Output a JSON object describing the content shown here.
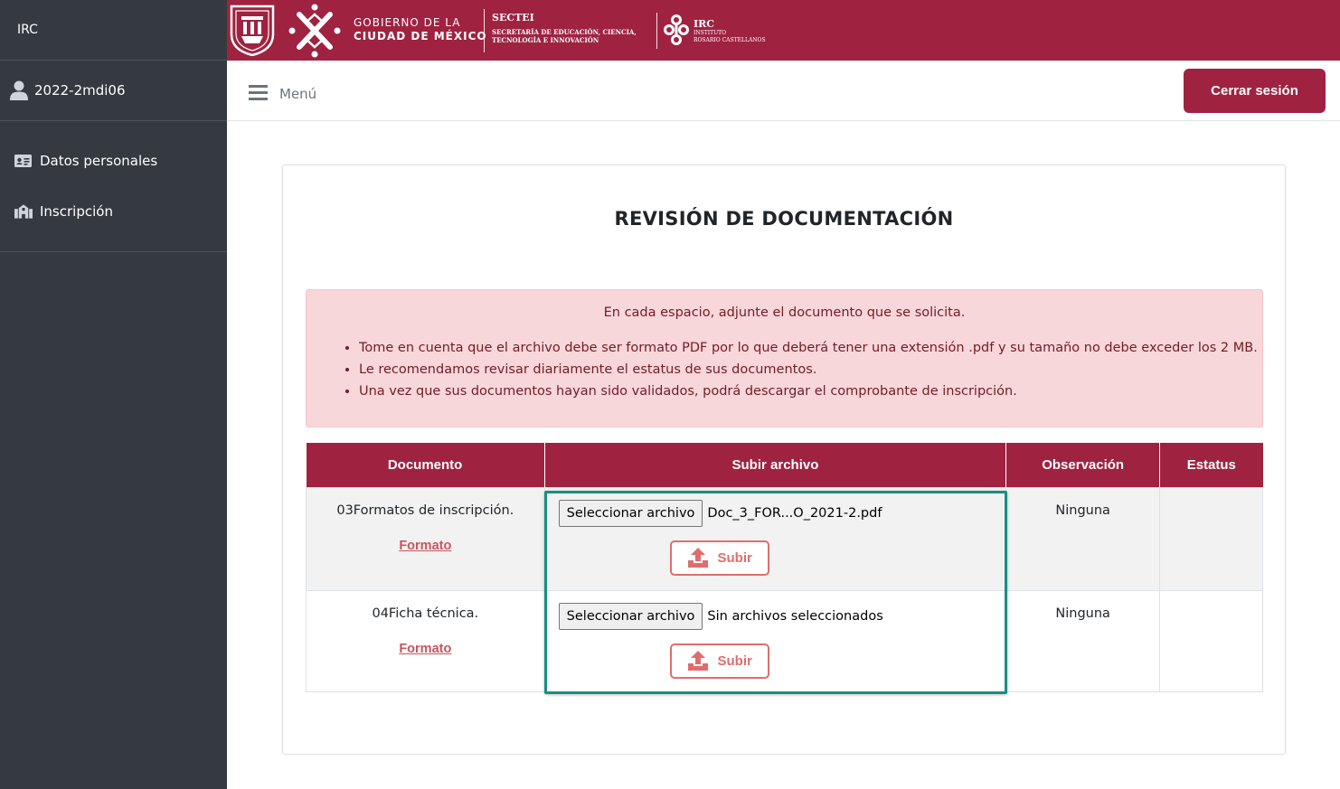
{
  "sidebar": {
    "brand": "IRC",
    "user": {
      "name": "2022-2mdi06",
      "icon": "user-icon"
    },
    "items": [
      {
        "label": "Datos personales",
        "icon": "id-card-icon"
      },
      {
        "label": "Inscripción",
        "icon": "school-icon"
      }
    ]
  },
  "banner": {
    "gob_line1": "GOBIERNO DE LA",
    "gob_line2": "CIUDAD DE MÉXICO",
    "sectei_title": "SECTEI",
    "sectei_line1": "SECRETARÍA DE EDUCACIÓN, CIENCIA,",
    "sectei_line2": "TECNOLOGÍA E INNOVACIÓN",
    "irc_title": "IRC",
    "irc_line1": "INSTITUTO",
    "irc_line2": "ROSARIO CASTELLANOS",
    "color": "#9f2241"
  },
  "topnav": {
    "menu_label": "Menú",
    "logout_label": "Cerrar sesión"
  },
  "main": {
    "title": "REVISIÓN DE DOCUMENTACIÓN",
    "alert": {
      "intro": "En cada espacio, adjunte el documento que se solicita.",
      "bullets": [
        "Tome en cuenta que el archivo debe ser formato PDF por lo que deberá tener una extensión .pdf y su tamaño no debe exceder los 2 MB.",
        "Le recomendamos revisar diariamente el estatus de sus documentos.",
        "Una vez que sus documentos hayan sido validados, podrá descargar el comprobante de inscripción."
      ]
    },
    "table": {
      "headers": [
        "Documento",
        "Subir archivo",
        "Observación",
        "Estatus"
      ],
      "rows": [
        {
          "document": "03Formatos de inscripción.",
          "formato": "Formato",
          "file_button": "Seleccionar archivo",
          "file_name": "Doc_3_FOR...O_2021-2.pdf",
          "upload": "Subir",
          "observation": "Ninguna",
          "status": ""
        },
        {
          "document": "04Ficha técnica.",
          "formato": "Formato",
          "file_button": "Seleccionar archivo",
          "file_name": "Sin archivos seleccionados",
          "upload": "Subir",
          "observation": "Ninguna",
          "status": ""
        }
      ]
    }
  }
}
